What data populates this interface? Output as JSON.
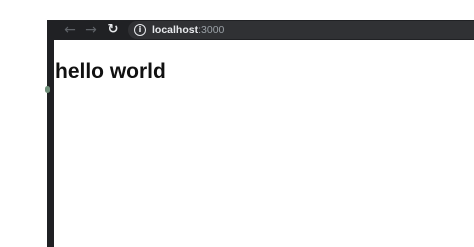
{
  "browser": {
    "back_glyph": "←",
    "forward_glyph": "→",
    "reload_glyph": "↻",
    "info_glyph": "i",
    "url_host": "localhost",
    "url_port": ":3000",
    "icons": [
      "back-arrow-icon",
      "forward-arrow-icon",
      "reload-icon",
      "info-icon"
    ]
  },
  "page": {
    "heading": "hello world"
  },
  "colors": {
    "toolbar": "#202124",
    "address_bar": "#303134",
    "url_text": "#e8eaed",
    "url_port_text": "#9aa0a6",
    "page_background": "#ffffff"
  }
}
